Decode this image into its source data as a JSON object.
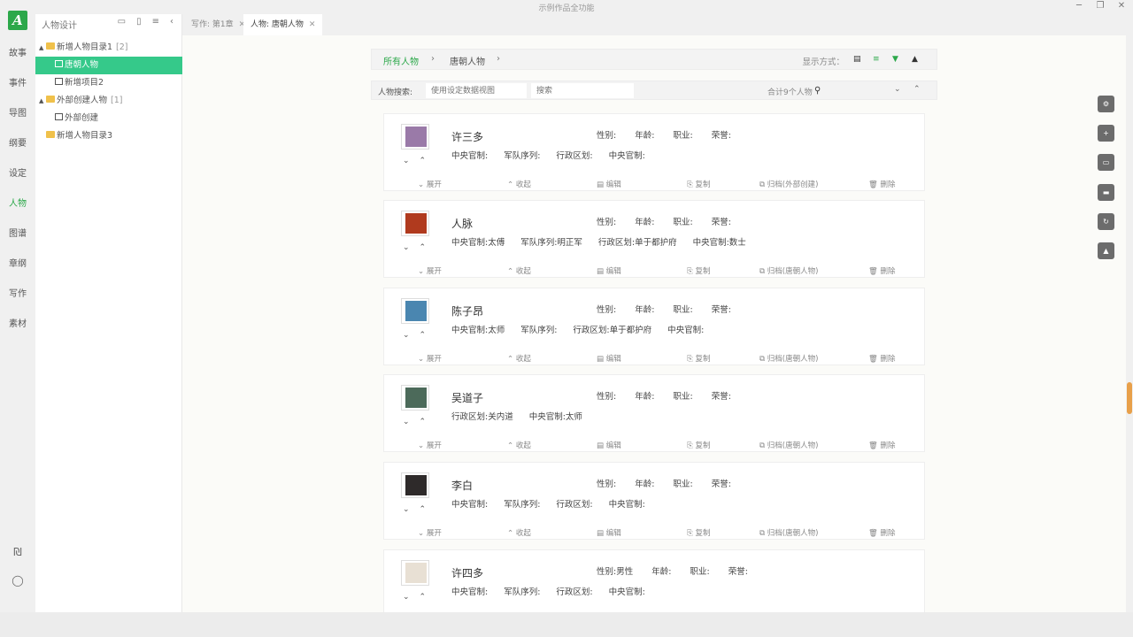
{
  "window": {
    "title": "示例作品全功能",
    "controls": [
      "─",
      "❐",
      "✕"
    ]
  },
  "rail": {
    "items": [
      "故事",
      "事件",
      "导图",
      "纲要",
      "设定",
      "人物",
      "图谱",
      "章纲",
      "写作",
      "素材"
    ],
    "active": "人物",
    "bottom_icons": [
      "₪",
      "◯"
    ]
  },
  "tree": {
    "title": "人物设计",
    "collapse_glyph": "‹",
    "rows": [
      {
        "label": "新增人物目录1",
        "count": "[2]"
      },
      {
        "label": "唐朝人物"
      },
      {
        "label": "新增项目2"
      },
      {
        "label": "外部创建人物",
        "count": "[1]"
      },
      {
        "label": "外部创建"
      },
      {
        "label": "新增人物目录3"
      }
    ]
  },
  "tabs": [
    {
      "label": "写作: 第1章"
    },
    {
      "label": "人物: 唐朝人物"
    }
  ],
  "breadcrumb": {
    "root": "所有人物",
    "current": "唐朝人物",
    "sep": "›",
    "display_mode_label": "显示方式："
  },
  "search": {
    "label": "人物搜索:",
    "view_placeholder": "使用设定数据视图",
    "placeholder": "搜索",
    "total": "合计9个人物"
  },
  "card_actions": {
    "expand": "展开",
    "collapse": "收起",
    "edit": "编辑",
    "copy": "复制",
    "delete": "删除"
  },
  "characters": [
    {
      "name": "许三多",
      "gender": "性别:",
      "age": "年龄:",
      "job": "职业:",
      "honor": "荣誉:",
      "attrs": [
        "中央官制:",
        "军队序列:",
        "行政区划:",
        "中央官制:"
      ],
      "archive": "归档(外部创建)",
      "color": "#9a7aa8"
    },
    {
      "name": "人脉",
      "gender": "性别:",
      "age": "年龄:",
      "job": "职业:",
      "honor": "荣誉:",
      "attrs": [
        "中央官制:太傅",
        "军队序列:明正军",
        "行政区划:单于都护府",
        "中央官制:数士"
      ],
      "archive": "归档(唐朝人物)",
      "color": "#b03a1e"
    },
    {
      "name": "陈子昂",
      "gender": "性别:",
      "age": "年龄:",
      "job": "职业:",
      "honor": "荣誉:",
      "attrs": [
        "中央官制:太师",
        "军队序列:",
        "行政区划:单于都护府",
        "中央官制:"
      ],
      "archive": "归档(唐朝人物)",
      "color": "#4a86b0"
    },
    {
      "name": "吴道子",
      "gender": "性别:",
      "age": "年龄:",
      "job": "职业:",
      "honor": "荣誉:",
      "attrs": [
        "行政区划:关内道",
        "中央官制:太师"
      ],
      "archive": "归档(唐朝人物)",
      "color": "#4c6a5a"
    },
    {
      "name": "李白",
      "gender": "性别:",
      "age": "年龄:",
      "job": "职业:",
      "honor": "荣誉:",
      "attrs": [
        "中央官制:",
        "军队序列:",
        "行政区划:",
        "中央官制:"
      ],
      "archive": "归档(唐朝人物)",
      "color": "#2e2a2a"
    },
    {
      "name": "许四多",
      "gender": "性别:男性",
      "age": "年龄:",
      "job": "职业:",
      "honor": "荣誉:",
      "attrs": [
        "中央官制:",
        "军队序列:",
        "行政区划:",
        "中央官制:"
      ],
      "archive": "",
      "color": "#e8e0d4"
    }
  ],
  "colors": {
    "accent": "#2ca84a",
    "selected": "#35c98a"
  }
}
